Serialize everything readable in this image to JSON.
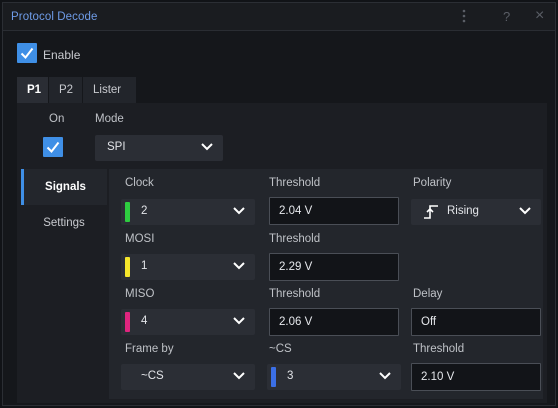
{
  "window": {
    "title": "Protocol Decode"
  },
  "titlebar": {
    "menu_icon": "more-vert-icon",
    "help_label": "?",
    "close_label": "×"
  },
  "enable": {
    "label": "Enable",
    "checked": true
  },
  "tabs": [
    {
      "label": "P1",
      "active": true
    },
    {
      "label": "P2",
      "active": false
    },
    {
      "label": "Lister",
      "active": false
    }
  ],
  "on": {
    "label": "On",
    "checked": true
  },
  "mode": {
    "label": "Mode",
    "value": "SPI"
  },
  "subtabs": [
    {
      "label": "Signals",
      "active": true
    },
    {
      "label": "Settings",
      "active": false
    }
  ],
  "clock": {
    "label": "Clock",
    "value": "2",
    "color": "#2ecc40"
  },
  "clock_threshold": {
    "label": "Threshold",
    "value": "2.04 V"
  },
  "polarity": {
    "label": "Polarity",
    "value": "Rising",
    "icon": "rising-edge-icon"
  },
  "mosi": {
    "label": "MOSI",
    "value": "1",
    "color": "#f5e62b"
  },
  "mosi_threshold": {
    "label": "Threshold",
    "value": "2.29 V"
  },
  "miso": {
    "label": "MISO",
    "value": "4",
    "color": "#e0257f"
  },
  "miso_threshold": {
    "label": "Threshold",
    "value": "2.06 V"
  },
  "delay": {
    "label": "Delay",
    "value": "Off"
  },
  "frame_by": {
    "label": "Frame by",
    "value": "~CS"
  },
  "cs": {
    "label": "~CS",
    "value": "3",
    "color": "#3b6fe6"
  },
  "cs_threshold": {
    "label": "Threshold",
    "value": "2.10 V"
  }
}
